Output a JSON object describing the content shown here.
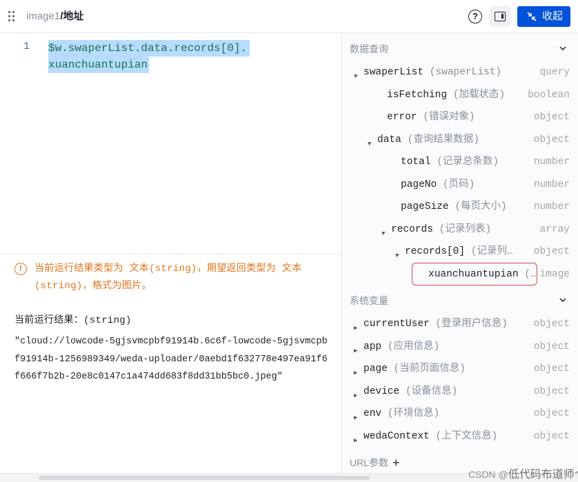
{
  "header": {
    "crumb_parent": "image1",
    "crumb_sep": "/",
    "crumb_current": "地址",
    "help_glyph": "?",
    "collapse_label": "收起"
  },
  "editor": {
    "line_number": "1",
    "code_line1": "$w.swaperList.data.records[0].",
    "code_line2": "xuanchuantupian"
  },
  "result": {
    "warning_icon_glyph": "!",
    "warning_text": "当前运行结果类型为 文本(string)，期望返回类型为 文本(string)，格式为图片。",
    "result_label": "当前运行结果：(string)",
    "result_value": "\"cloud://lowcode-5gjsvmcpbf91914b.6c6f-lowcode-5gjsvmcpbf91914b-1256989349/weda-uploader/0aebd1f632778e497ea91f6f666f7b2b-20e8c0147c1a474dd683f8dd31bb5bc0.jpeg\""
  },
  "panel": {
    "data_query_title": "数据查询",
    "system_vars_title": "系统变量",
    "url_params_title": "URL参数",
    "url_params_plus": "+",
    "query_tree": [
      {
        "name": "swaperList",
        "zh": "(swaperList)",
        "type": "query",
        "caret": "▼"
      },
      {
        "name": "isFetching",
        "zh": "(加载状态)",
        "type": "boolean",
        "caret": ""
      },
      {
        "name": "error",
        "zh": "(错误对象)",
        "type": "object",
        "caret": ""
      },
      {
        "name": "data",
        "zh": "(查询结果数据)",
        "type": "object",
        "caret": "▼"
      },
      {
        "name": "total",
        "zh": "(记录总条数)",
        "type": "number",
        "caret": ""
      },
      {
        "name": "pageNo",
        "zh": "(页码)",
        "type": "number",
        "caret": ""
      },
      {
        "name": "pageSize",
        "zh": "(每页大小)",
        "type": "number",
        "caret": ""
      },
      {
        "name": "records",
        "zh": "(记录列表)",
        "type": "array",
        "caret": "▼"
      },
      {
        "name": "records[0]",
        "zh": "(记录列…",
        "type": "object",
        "caret": "▼"
      },
      {
        "name": "xuanchuantupian",
        "zh": "(…",
        "type": "image",
        "caret": ""
      }
    ],
    "system_tree": [
      {
        "name": "currentUser",
        "zh": "(登录用户信息)",
        "type": "object",
        "caret": "▶"
      },
      {
        "name": "app",
        "zh": "(应用信息)",
        "type": "object",
        "caret": "▶"
      },
      {
        "name": "page",
        "zh": "(当前页面信息)",
        "type": "object",
        "caret": "▶"
      },
      {
        "name": "device",
        "zh": "(设备信息)",
        "type": "object",
        "caret": "▶"
      },
      {
        "name": "env",
        "zh": "(环境信息)",
        "type": "object",
        "caret": "▶"
      },
      {
        "name": "wedaContext",
        "zh": "(上下文信息)",
        "type": "object",
        "caret": "▶"
      }
    ]
  },
  "watermark": {
    "prefix": "CSDN @",
    "name": "低代码布道师",
    "tail": "个"
  },
  "colors": {
    "primary": "#0052d9",
    "warning": "#e37318",
    "highlight_border": "#d54941",
    "selection": "#b7dcff"
  }
}
